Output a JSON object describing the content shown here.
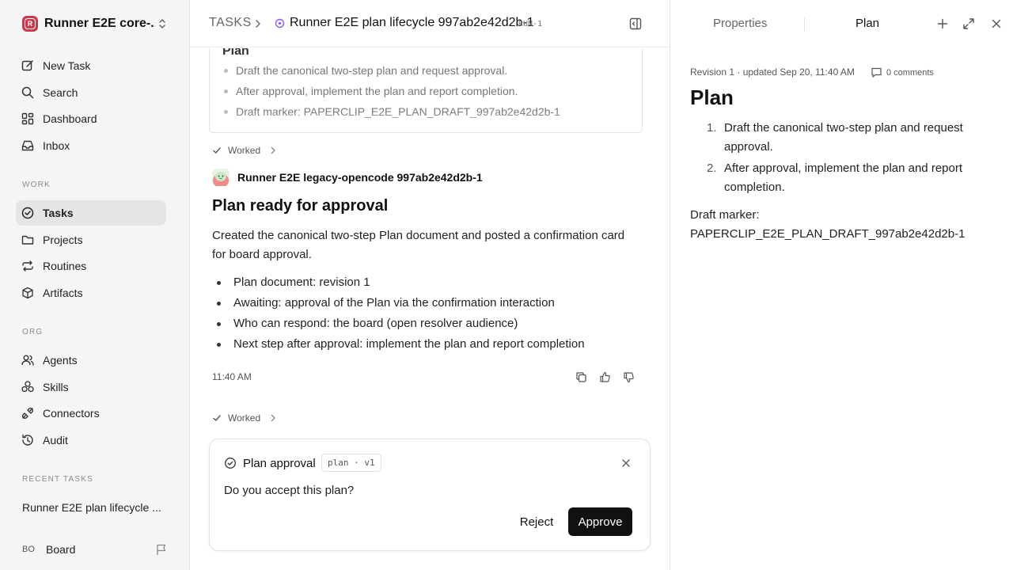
{
  "sidebar": {
    "workspace": {
      "logo_letter": "R",
      "name": "Runner E2E core-..."
    },
    "primary_nav": [
      {
        "label": "New Task",
        "icon": "edit-icon"
      },
      {
        "label": "Search",
        "icon": "search-icon"
      },
      {
        "label": "Dashboard",
        "icon": "dashboard-icon"
      },
      {
        "label": "Inbox",
        "icon": "inbox-icon"
      }
    ],
    "work_label": "WORK",
    "work_nav": [
      {
        "label": "Tasks",
        "icon": "check-circle-icon",
        "active": true
      },
      {
        "label": "Projects",
        "icon": "folder-icon"
      },
      {
        "label": "Routines",
        "icon": "repeat-icon"
      },
      {
        "label": "Artifacts",
        "icon": "cube-icon"
      }
    ],
    "org_label": "ORG",
    "org_nav": [
      {
        "label": "Agents",
        "icon": "users-icon"
      },
      {
        "label": "Skills",
        "icon": "skills-icon"
      },
      {
        "label": "Connectors",
        "icon": "plug-icon"
      },
      {
        "label": "Audit",
        "icon": "history-icon"
      }
    ],
    "recent_label": "RECENT TASKS",
    "recent_tasks": [
      "Runner E2E plan lifecycle ..."
    ],
    "user": {
      "initials": "BO",
      "name": "Board"
    }
  },
  "header": {
    "breadcrumb_root": "TASKS",
    "task_title": "Runner E2E plan lifecycle 997ab2e42d2b-1",
    "task_id": "RUN-1"
  },
  "main": {
    "plan_card": {
      "title": "Plan",
      "items": [
        "Draft the canonical two-step plan and request approval.",
        "After approval, implement the plan and report completion.",
        "Draft marker: PAPERCLIP_E2E_PLAN_DRAFT_997ab2e42d2b-1"
      ]
    },
    "worked_label": "Worked",
    "agent_name": "Runner E2E legacy-opencode 997ab2e42d2b-1",
    "message": {
      "title": "Plan ready for approval",
      "body": "Created the canonical two-step Plan document and posted a confirmation card for board approval.",
      "bullets": [
        "Plan document: revision 1",
        "Awaiting: approval of the Plan via the confirmation interaction",
        "Who can respond: the board (open resolver audience)",
        "Next step after approval: implement the plan and report completion"
      ],
      "time": "11:40 AM"
    },
    "approval": {
      "title": "Plan approval",
      "tag": "plan · v1",
      "question": "Do you accept this plan?",
      "reject_label": "Reject",
      "approve_label": "Approve"
    }
  },
  "right_panel": {
    "tabs": [
      {
        "label": "Properties",
        "active": false
      },
      {
        "label": "Plan",
        "active": true
      }
    ],
    "revision_line": "Revision 1 · updated Sep 20, 11:40 AM",
    "comments_label": "0 comments",
    "doc_title": "Plan",
    "doc_items": [
      {
        "num": "1.",
        "text": "Draft the canonical two-step plan and request approval."
      },
      {
        "num": "2.",
        "text": "After approval, implement the plan and report completion."
      }
    ],
    "marker_label": "Draft marker:",
    "marker_value": "PAPERCLIP_E2E_PLAN_DRAFT_997ab2e42d2b-1"
  },
  "colors": {
    "accent_dark": "#111111",
    "workspace_logo": "#c93a4e",
    "status_purple": "#8b5cf6",
    "sidebar_bg": "#f5f5f5",
    "active_nav_bg": "#e5e5e5"
  }
}
